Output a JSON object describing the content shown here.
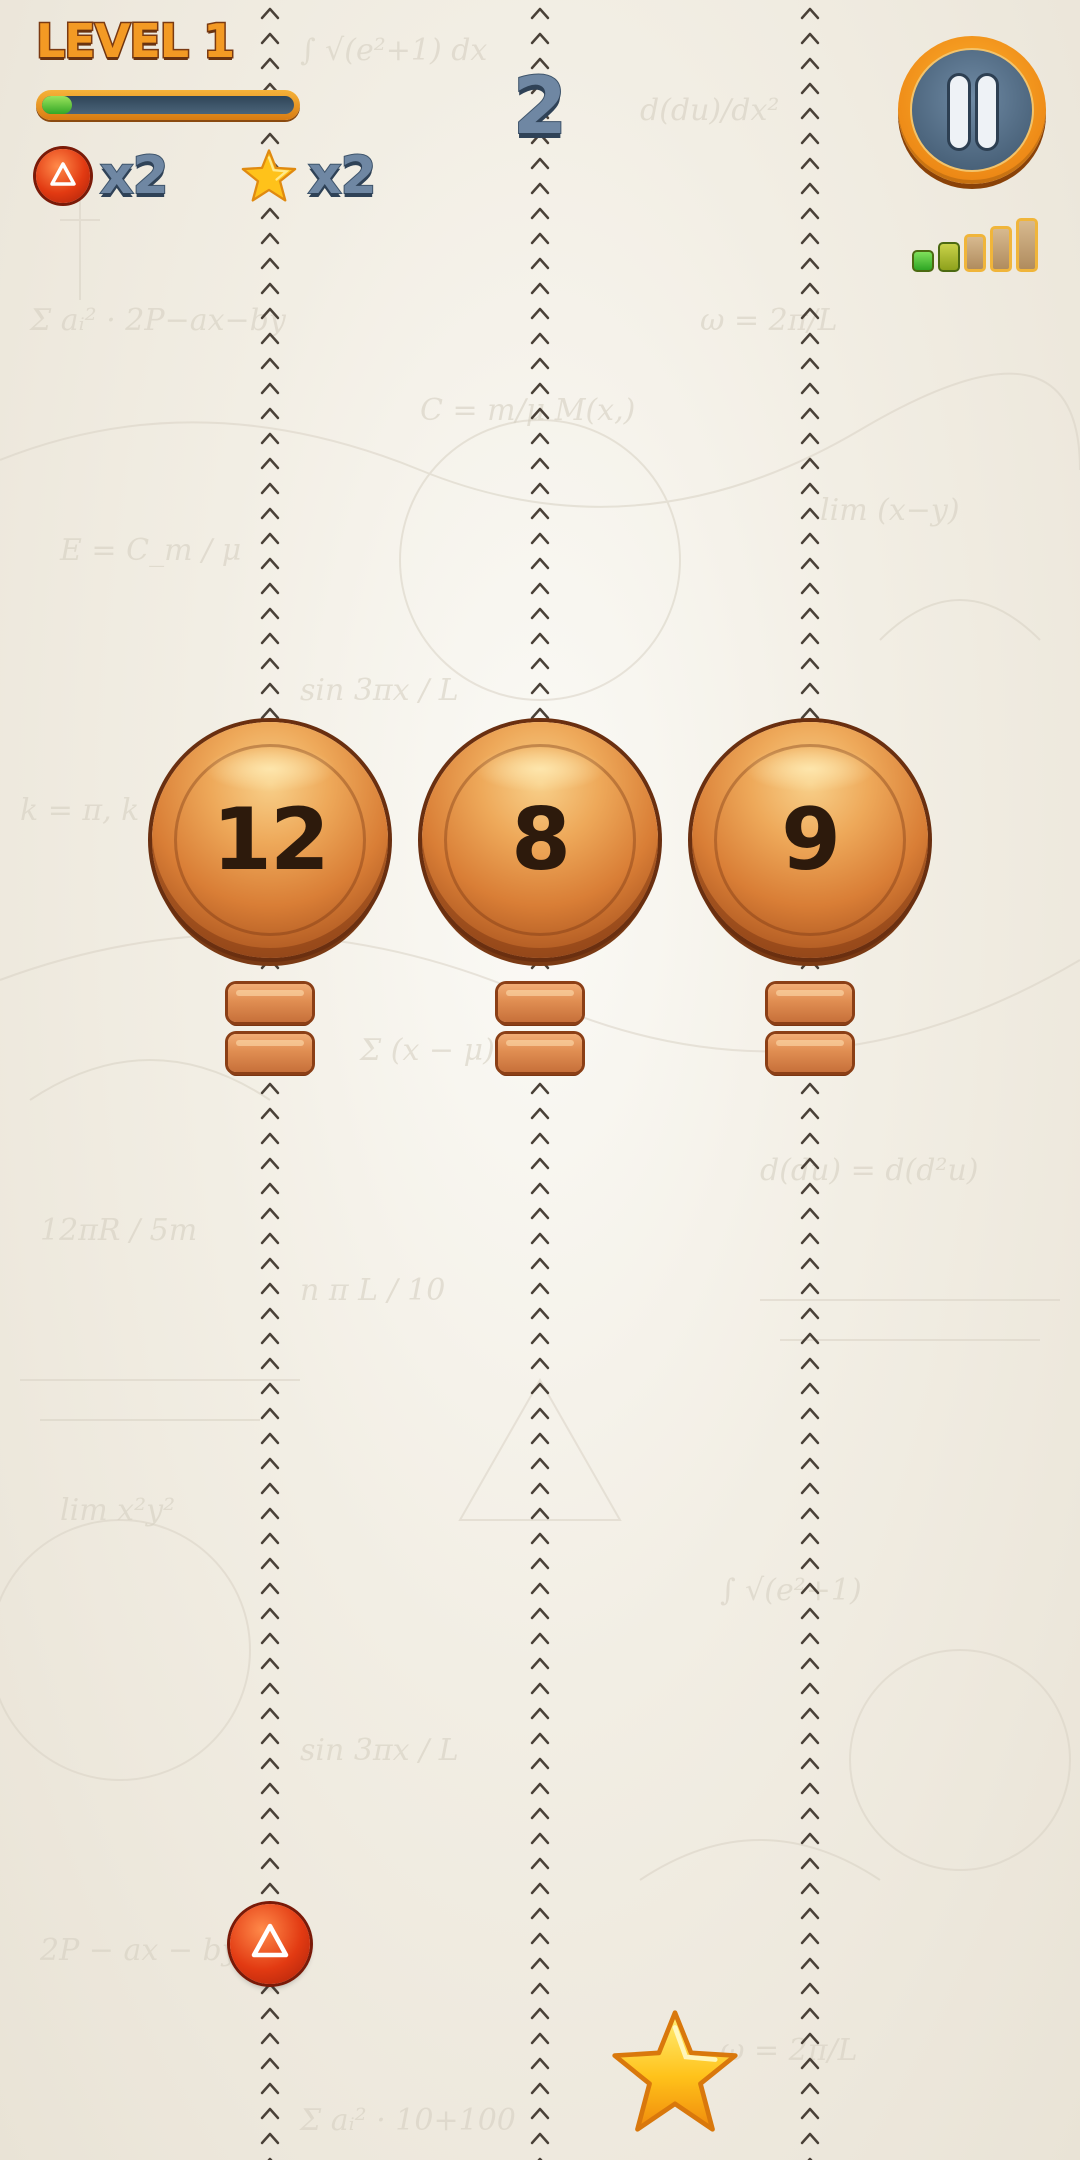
{
  "hud": {
    "level_label": "LEVEL 1",
    "level_progress": 0.12,
    "score": "2",
    "ball_counter": {
      "icon": "red-triangle-ball-icon",
      "text": "x2"
    },
    "star_counter": {
      "icon": "star-icon",
      "text": "x2"
    },
    "pause_icon": "pause-icon",
    "signal": {
      "icon": "signal-strength-icon",
      "bars_total": 5,
      "bars_lit": 2
    }
  },
  "lanes": [
    {
      "ball_number": "12",
      "planks": 2
    },
    {
      "ball_number": "8",
      "planks": 2
    },
    {
      "ball_number": "9",
      "planks": 2
    }
  ],
  "player": {
    "icon": "red-triangle-ball-icon",
    "lane": 1
  },
  "pickup": {
    "icon": "star-icon"
  },
  "colors": {
    "background": "#f2eee4",
    "wood": "#d97e36",
    "wood_dark": "#6a2f10",
    "hud_text_blue": "#6f87a3",
    "level_orange": "#f39a24",
    "progress_green": "#33a726",
    "player_red": "#e23a12",
    "star_yellow": "#ffc21a"
  }
}
